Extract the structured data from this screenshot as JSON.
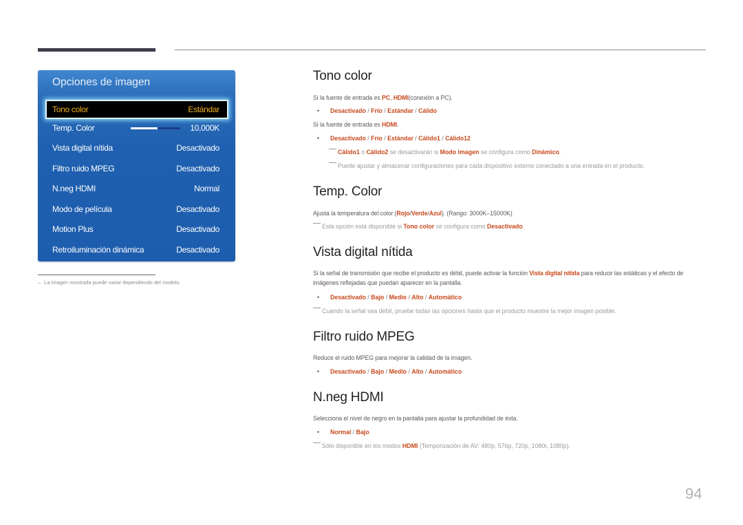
{
  "panel": {
    "title": "Opciones de imagen",
    "items": [
      {
        "label": "Tono color",
        "value": "Estándar",
        "selected": true
      },
      {
        "label": "Temp. Color",
        "value": "10,000K",
        "slider_fraction": 0.54
      },
      {
        "label": "Vista digital nítida",
        "value": "Desactivado"
      },
      {
        "label": "Filtro ruido MPEG",
        "value": "Desactivado"
      },
      {
        "label": "N.neg HDMI",
        "value": "Normal"
      },
      {
        "label": "Modo de película",
        "value": "Desactivado"
      },
      {
        "label": "Motion Plus",
        "value": "Desactivado"
      },
      {
        "label": "Retroiluminación dinámica",
        "value": "Desactivado"
      }
    ],
    "footnote": "La imagen mostrada puede variar dependiendo del modelo."
  },
  "sections": {
    "tono": {
      "title": "Tono color",
      "line1_pre": "Si la fuente de entrada es ",
      "line1_pc": "PC",
      "line1_comma": ", ",
      "line1_hdmi": "HDMI",
      "line1_post": "(conexión a PC).",
      "opts1": [
        "Desactivado",
        "Frío",
        "Estándar",
        "Cálido"
      ],
      "line2_pre": "Si la fuente de entrada es ",
      "line2_hdmi": "HDMI",
      "line2_post": ".",
      "opts2": [
        "Desactivado",
        "Frío",
        "Estándar",
        "Cálido1",
        "Cálido12"
      ],
      "note1_a": "Cálido1",
      "note1_o": " o ",
      "note1_b": "Cálido2",
      "note1_mid": " se desactivarán si ",
      "note1_c": "Modo imagen",
      "note1_mid2": " se configura como ",
      "note1_d": "Dinámico",
      "note1_end": ".",
      "note2": "Puede ajustar y almacenar configuraciones para cada dispositivo externo conectado a una entrada en el producto."
    },
    "temp": {
      "title": "Temp. Color",
      "desc_pre": "Ajusta la temperatura del color (",
      "desc_rojo": "Rojo",
      "desc_verde": "Verde",
      "desc_azul": "Azul",
      "desc_post": "). (Rango: 3000K–15000K)",
      "note_pre": "Esta opción está disponible si ",
      "note_a": "Tono color",
      "note_mid": " se configura como ",
      "note_b": "Desactivado",
      "note_end": "."
    },
    "vista": {
      "title": "Vista digital nítida",
      "desc_pre": "Si la señal de transmisión que recibe el producto es débil, puede activar la función ",
      "desc_hl": "Vista digital nítida",
      "desc_post": " para reducir las estáticas y el efecto de imágenes reflejadas que puedan aparecer en la pantalla.",
      "opts": [
        "Desactivado",
        "Bajo",
        "Medio",
        "Alto",
        "Automático"
      ],
      "note": "Cuando la señal sea débil, pruebe todas las opciones hasta que el producto muestre la mejor imagen posible."
    },
    "mpeg": {
      "title": "Filtro ruido MPEG",
      "desc": "Reduce el ruido MPEG para mejorar la calidad de la imagen.",
      "opts": [
        "Desactivado",
        "Bajo",
        "Medio",
        "Alto",
        "Automático"
      ]
    },
    "nneg": {
      "title": "N.neg HDMI",
      "desc": "Selecciona el nivel de negro en la pantalla para ajustar la profundidad de ésta.",
      "opts": [
        "Normal",
        "Bajo"
      ],
      "note_pre": "Sólo disponible en los modos ",
      "note_hl": "HDMI",
      "note_post": " (Temporización de AV: 480p, 576p, 720p, 1080i, 1080p)."
    }
  },
  "page_number": "94",
  "colors": {
    "accent": "#c7481b",
    "panel_blue": "#1f60b0",
    "selected_text": "#f0b21a"
  }
}
